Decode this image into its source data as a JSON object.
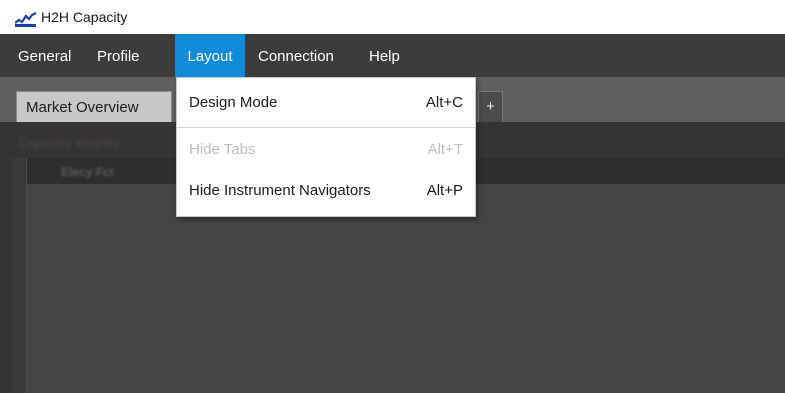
{
  "window": {
    "title": "H2H Capacity",
    "icon": "chart-line-icon",
    "icon_color": "#1a3fa8"
  },
  "menubar": {
    "items": [
      {
        "label": "General"
      },
      {
        "label": "Profile"
      },
      {
        "label": "Layout",
        "active": true
      },
      {
        "label": "Connection"
      },
      {
        "label": "Help"
      }
    ],
    "background": "#3c3c3c",
    "active_color": "#0f8bd9"
  },
  "tabs": {
    "items": [
      {
        "label": "Market Overview"
      }
    ],
    "add_label": "+"
  },
  "content": {
    "panel_title": "Capacity display",
    "inner_header": "Elecy Fct"
  },
  "layout_menu": {
    "items": [
      {
        "label": "Design Mode",
        "shortcut": "Alt+C",
        "enabled": true
      },
      {
        "label": "Hide Tabs",
        "shortcut": "Alt+T",
        "enabled": false
      },
      {
        "label": "Hide Instrument Navigators",
        "shortcut": "Alt+P",
        "enabled": true
      }
    ]
  }
}
